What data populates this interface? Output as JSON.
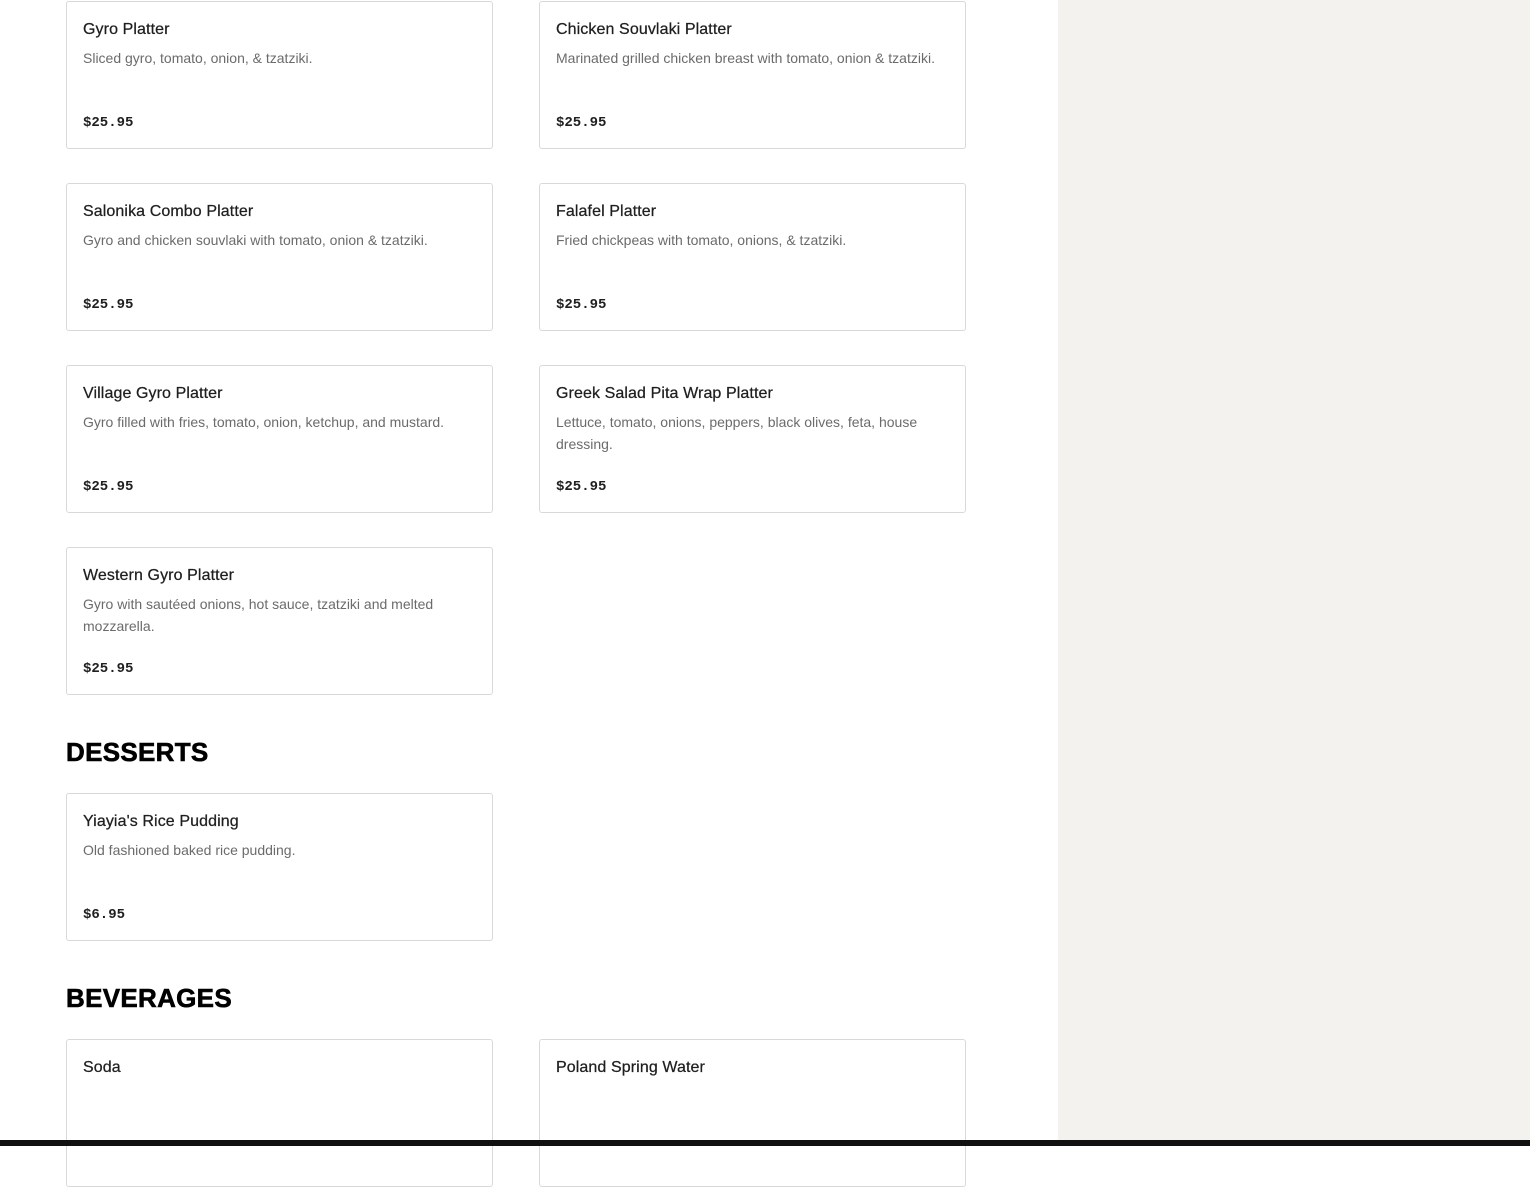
{
  "platters": [
    {
      "name": "Gyro Platter",
      "description": "Sliced gyro, tomato, onion, & tzatziki.",
      "price": "$25.95"
    },
    {
      "name": "Chicken Souvlaki Platter",
      "description": "Marinated grilled chicken breast with tomato, onion & tzatziki.",
      "price": "$25.95"
    },
    {
      "name": "Salonika Combo Platter",
      "description": "Gyro and chicken souvlaki with tomato, onion & tzatziki.",
      "price": "$25.95"
    },
    {
      "name": "Falafel Platter",
      "description": "Fried chickpeas with tomato, onions, & tzatziki.",
      "price": "$25.95"
    },
    {
      "name": "Village Gyro Platter",
      "description": "Gyro filled with fries, tomato, onion, ketchup, and mustard.",
      "price": "$25.95"
    },
    {
      "name": "Greek Salad Pita Wrap Platter",
      "description": "Lettuce, tomato, onions, peppers, black olives, feta, house dressing.",
      "price": "$25.95"
    },
    {
      "name": "Western Gyro Platter",
      "description": "Gyro with sautéed onions, hot sauce, tzatziki and melted mozzarella.",
      "price": "$25.95"
    }
  ],
  "desserts": {
    "title": "DESSERTS",
    "items": [
      {
        "name": "Yiayia's Rice Pudding",
        "description": "Old fashioned baked rice pudding.",
        "price": "$6.95"
      }
    ]
  },
  "beverages": {
    "title": "BEVERAGES",
    "items": [
      {
        "name": "Soda"
      },
      {
        "name": "Poland Spring Water"
      }
    ]
  },
  "colors": {
    "page_background": "#ffffff",
    "sidebar_background": "#f3f2ef",
    "card_border": "#d9d9d9",
    "name_text": "#1f1f1f",
    "description_text": "#6b6b6b",
    "heading_text": "#000000"
  }
}
